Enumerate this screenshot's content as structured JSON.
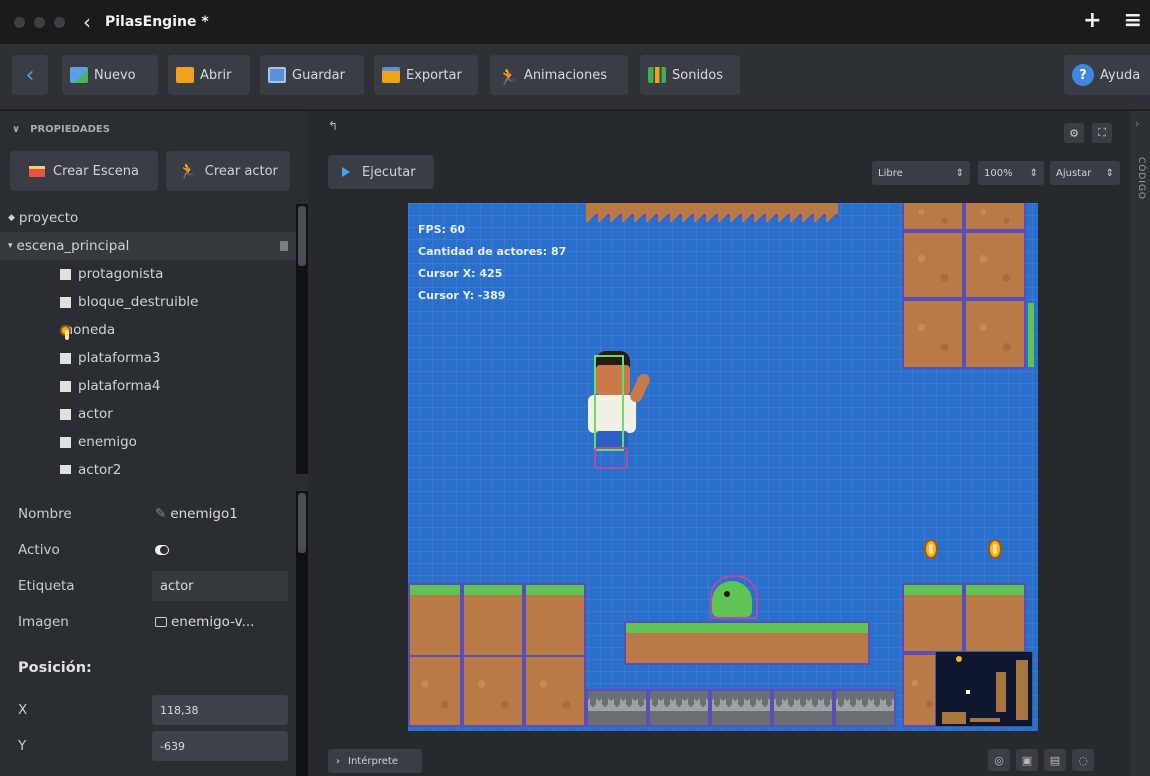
{
  "window": {
    "title": "PilasEngine *"
  },
  "toolbar": {
    "nuevo": "Nuevo",
    "abrir": "Abrir",
    "guardar": "Guardar",
    "exportar": "Exportar",
    "animaciones": "Animaciones",
    "sonidos": "Sonidos",
    "ayuda": "Ayuda"
  },
  "left": {
    "section_title": "PROPIEDADES",
    "crear_escena": "Crear Escena",
    "crear_actor": "Crear actor",
    "tree": [
      {
        "label": "proyecto",
        "type": "root"
      },
      {
        "label": "escena_principal",
        "type": "scene"
      },
      {
        "label": "protagonista",
        "type": "actor"
      },
      {
        "label": "bloque_destruible",
        "type": "actor"
      },
      {
        "label": "moneda",
        "type": "coin"
      },
      {
        "label": "plataforma3",
        "type": "actor"
      },
      {
        "label": "plataforma4",
        "type": "actor"
      },
      {
        "label": "actor",
        "type": "actor"
      },
      {
        "label": "enemigo",
        "type": "actor"
      },
      {
        "label": "actor2",
        "type": "actor"
      }
    ],
    "props": {
      "nombre_label": "Nombre",
      "nombre_value": "enemigo1",
      "activo_label": "Activo",
      "etiqueta_label": "Etiqueta",
      "etiqueta_value": "actor",
      "imagen_label": "Imagen",
      "imagen_value": "enemigo-v...",
      "posicion_label": "Posición:",
      "x_label": "X",
      "x_value": "118,38",
      "y_label": "Y",
      "y_value": "-639"
    }
  },
  "editor": {
    "run_label": "Ejecutar",
    "mode": "Libre",
    "zoom": "100%",
    "fit": "Ajustar",
    "interpreter": "Intérprete",
    "side_tab": "CÓDIGO",
    "hud": {
      "fps": "FPS: 60",
      "actors": "Cantidad de actores: 87",
      "cursor_x": "Cursor X: 425",
      "cursor_y": "Cursor Y: -389"
    }
  },
  "colors": {
    "canvas_bg": "#2a6fcc",
    "accent": "#4aa3f0",
    "grass": "#5fc454",
    "dirt": "#b97a47"
  }
}
